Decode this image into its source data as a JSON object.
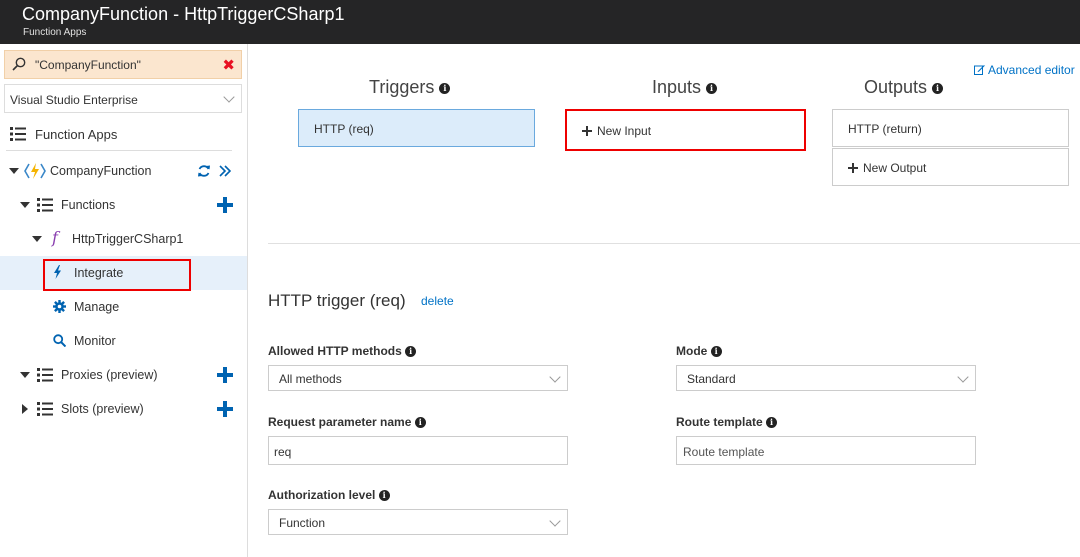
{
  "header": {
    "title": "CompanyFunction - HttpTriggerCSharp1",
    "subtitle": "Function Apps"
  },
  "sidebar": {
    "search_value": "\"CompanyFunction\"",
    "subscription": "Visual Studio Enterprise",
    "function_apps_label": "Function Apps",
    "tree": {
      "app_name": "CompanyFunction",
      "functions_label": "Functions",
      "function_name": "HttpTriggerCSharp1",
      "integrate_label": "Integrate",
      "manage_label": "Manage",
      "monitor_label": "Monitor",
      "proxies_label": "Proxies (preview)",
      "slots_label": "Slots (preview)"
    }
  },
  "main": {
    "advanced_editor": "Advanced editor",
    "triggers_heading": "Triggers",
    "inputs_heading": "Inputs",
    "outputs_heading": "Outputs",
    "trigger_item": "HTTP (req)",
    "new_input": "New Input",
    "output_item": "HTTP (return)",
    "new_output": "New Output",
    "section_title": "HTTP trigger (req)",
    "delete_label": "delete",
    "fields": {
      "methods_label": "Allowed HTTP methods",
      "methods_value": "All methods",
      "mode_label": "Mode",
      "mode_value": "Standard",
      "param_label": "Request parameter name",
      "param_value": "req",
      "route_label": "Route template",
      "route_placeholder": "Route template",
      "auth_label": "Authorization level",
      "auth_value": "Function"
    }
  },
  "colors": {
    "header_bg": "#252526",
    "accent_blue": "#0063b1",
    "highlight_red": "#e00000",
    "search_bg": "#fbe6cf",
    "selected_bg": "#e6f0fa"
  }
}
